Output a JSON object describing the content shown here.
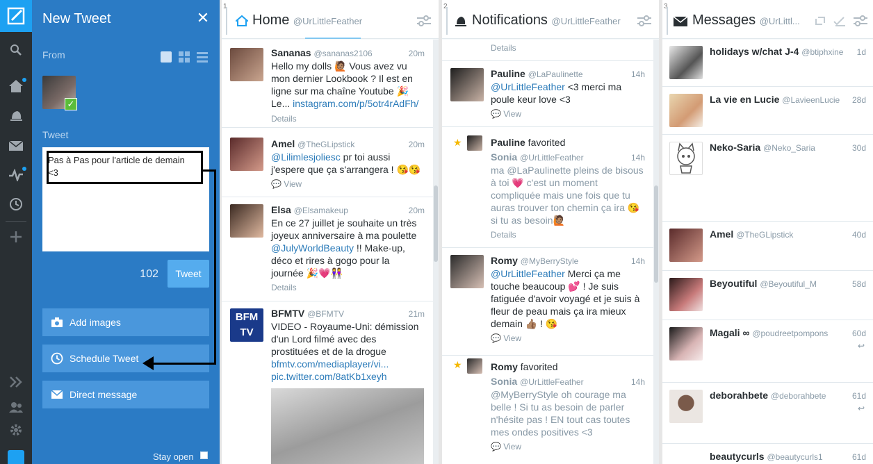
{
  "rail": {
    "icons": [
      "compose-icon",
      "search-icon",
      "home-icon",
      "notifications-icon",
      "messages-icon",
      "activity-icon",
      "scheduled-icon",
      "add-column-icon",
      "expand-icon",
      "accounts-icon",
      "settings-icon",
      "twitter-icon"
    ]
  },
  "compose": {
    "title": "New Tweet",
    "close": "✕",
    "from_label": "From",
    "tweet_label": "Tweet",
    "tweet_text_1": "Pas à Pas pour l'article de demain",
    "tweet_text_2": "<3",
    "char_count": "102",
    "tweet_button": "Tweet",
    "add_images": "Add images",
    "schedule_tweet": "Schedule Tweet",
    "direct_message": "Direct message",
    "stay_open": "Stay open"
  },
  "columns": {
    "home": {
      "number": "1",
      "title": "Home",
      "handle": "@UrLittleFeather",
      "tweets": [
        {
          "name": "Sananas",
          "handle": "@sananas2106",
          "time": "20m",
          "l1": "Hello my dolls 🙋🏽 Vous avez vu",
          "l2": "mon dernier Lookbook ? Il est en",
          "l3": "ligne sur ma chaîne Youtube 🎉",
          "l4a": "Le...",
          "l4b": "instagram.com/p/5otr4rAdFh/",
          "meta": "Details"
        },
        {
          "name": "Amel ",
          "handle": "@TheGLipstick",
          "time": "20m",
          "l1": "@Lilimlesjoliesc",
          "l1b": " pr toi aussi",
          "l2": "j'espere que ça s'arrangera ! 😘😘",
          "meta": "View"
        },
        {
          "name": "Elsa",
          "handle": "@Elsamakeup",
          "time": "20m",
          "l1": "En ce 27 juillet je souhaite un très",
          "l2": "joyeux anniversaire à ma poulette",
          "l3a": "@JulyWorldBeauty",
          "l3b": " !! Make-up,",
          "l4": "déco et rires à gogo pour la",
          "l5": "journée 🎉💗👭",
          "meta": "Details"
        },
        {
          "name": "BFMTV",
          "handle": "@BFMTV",
          "time": "21m",
          "l1": "VIDEO - Royaume-Uni: démission",
          "l2": "d'un Lord filmé avec des",
          "l3": "prostituées et de la drogue",
          "l4": "bfmtv.com/mediaplayer/vi...",
          "l5": "pic.twitter.com/8atKb1xeyh",
          "logo": "BFM TV"
        }
      ]
    },
    "notifications": {
      "number": "2",
      "title": "Notifications",
      "handle": "@UrLittleFeather",
      "top_meta": "Details",
      "items": [
        {
          "name": "Pauline",
          "handle": "@LaPaulinette",
          "time": "14h",
          "l1a": "@UrLittleFeather",
          "l1b": " <3 merci ma",
          "l2": "poule keur love <3",
          "meta": "View"
        },
        {
          "actor": "Pauline",
          "action": " favorited",
          "name": "Sonia",
          "handle": "@UrLittleFeather",
          "time": "14h",
          "l1": "ma @LaPaulinette pleins de bisous",
          "l2": "à toi 💗 c'est un moment",
          "l3": "compliquée mais une fois que tu",
          "l4": "auras trouver ton chemin ça ira 😘",
          "l5": "si tu as besoin🙋🏽",
          "meta": "Details"
        },
        {
          "name": "Romy ",
          "handle": "@MyBerryStyle",
          "time": "14h",
          "l1a": "@UrLittleFeather",
          "l1b": " Merci ça me",
          "l2": "touche beaucoup 💕 ! Je suis",
          "l3": "fatiguée d'avoir voyagé et je suis à",
          "l4": "fleur de peau mais ça ira mieux",
          "l5": "demain 👍🏽 ! 😘",
          "meta": "View"
        },
        {
          "actor": "Romy ",
          "action": " favorited",
          "name": "Sonia",
          "handle": "@UrLittleFeather",
          "time": "14h",
          "l1": "@MyBerryStyle oh courage ma",
          "l2": "belle ! Si tu as besoin de parler",
          "l3": "n'hésite pas ! EN tout cas toutes",
          "l4": "mes ondes positives <3",
          "meta": "View"
        }
      ]
    },
    "messages": {
      "number": "3",
      "title": "Messages",
      "handle": "@UrLittl...",
      "items": [
        {
          "name": "holidays w/chat J-4",
          "handle": "@btiphxine",
          "time": "1d"
        },
        {
          "name": "La vie en Lucie",
          "handle": "@LavieenLucie",
          "time": "28d"
        },
        {
          "name": "Neko-Saria",
          "handle": "@Neko_Saria",
          "time": "30d"
        },
        {
          "name": "Amel ",
          "handle": "@TheGLipstick",
          "time": "40d"
        },
        {
          "name": "Beyoutiful",
          "handle": "@Beyoutiful_M",
          "time": "58d"
        },
        {
          "name": "Magali ∞",
          "handle": "@poudreetpompons",
          "time": "60d"
        },
        {
          "name": "deborahbete",
          "handle": "@deborahbete",
          "time": "61d"
        },
        {
          "name": " beautycurls",
          "handle": "@beautycurls1",
          "time": "61d"
        }
      ]
    }
  },
  "colors": {
    "rail": "#292f33",
    "compose": "#2b7bc5",
    "accent": "#1da1f2",
    "link": "#2b7bb9"
  }
}
